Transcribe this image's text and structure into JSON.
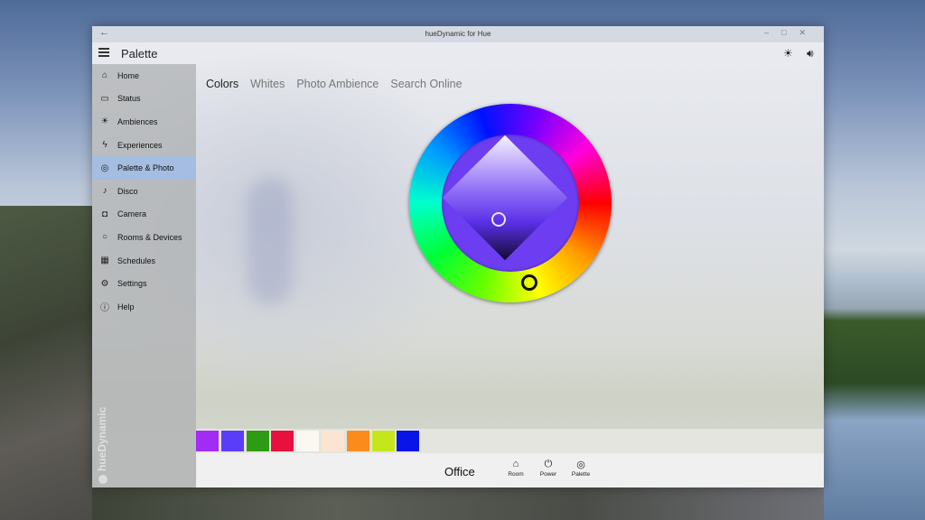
{
  "window": {
    "title": "hueDynamic for Hue",
    "back_icon": "back-arrow-icon",
    "controls": [
      "minimize-icon",
      "maximize-icon",
      "close-icon"
    ]
  },
  "header": {
    "page_title": "Palette",
    "menu_icon": "hamburger-icon",
    "brightness_icon": "sun-icon",
    "sound_icon": "speaker-icon"
  },
  "sidebar": {
    "items": [
      {
        "label": "Home",
        "icon": "home-icon",
        "glyph": "⌂",
        "active": false
      },
      {
        "label": "Status",
        "icon": "status-icon",
        "glyph": "▭",
        "active": false
      },
      {
        "label": "Ambiences",
        "icon": "sun-icon",
        "glyph": "☀",
        "active": false
      },
      {
        "label": "Experiences",
        "icon": "lightning-icon",
        "glyph": "ϟ",
        "active": false
      },
      {
        "label": "Palette & Photo",
        "icon": "palette-icon",
        "glyph": "◎",
        "active": true
      },
      {
        "label": "Disco",
        "icon": "music-note-icon",
        "glyph": "♪",
        "active": false
      },
      {
        "label": "Camera",
        "icon": "camera-icon",
        "glyph": "◘",
        "active": false
      },
      {
        "label": "Rooms & Devices",
        "icon": "lightbulb-icon",
        "glyph": "○",
        "active": false
      },
      {
        "label": "Schedules",
        "icon": "calendar-icon",
        "glyph": "▦",
        "active": false
      },
      {
        "label": "Settings",
        "icon": "gear-icon",
        "glyph": "⚙",
        "active": false
      },
      {
        "label": "Help",
        "icon": "info-icon",
        "glyph": "ⓘ",
        "active": false
      }
    ],
    "brand": "hueDynamic"
  },
  "tabs": [
    {
      "label": "Colors",
      "active": true
    },
    {
      "label": "Whites",
      "active": false
    },
    {
      "label": "Photo Ambience",
      "active": false
    },
    {
      "label": "Search Online",
      "active": false
    }
  ],
  "color_picker": {
    "selected_hue_color": "#6d3df2"
  },
  "palette": {
    "swatches": [
      "#a22bf5",
      "#5a3df6",
      "#2f9b14",
      "#e8103f",
      "#fbf7f1",
      "#fbe5d2",
      "#fb8c1c",
      "#c6e61c",
      "#0814e8"
    ]
  },
  "bottom_bar": {
    "room_name": "Office",
    "buttons": [
      {
        "label": "Room",
        "icon": "home-icon",
        "glyph": "⌂"
      },
      {
        "label": "Power",
        "icon": "power-icon",
        "glyph": "⏻"
      },
      {
        "label": "Palette",
        "icon": "palette-icon",
        "glyph": "◎"
      }
    ]
  }
}
